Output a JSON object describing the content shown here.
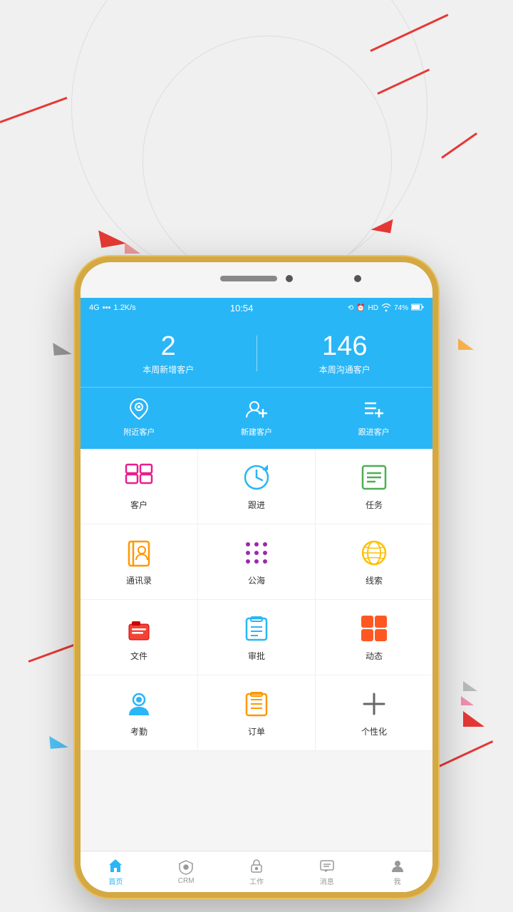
{
  "background": {
    "color": "#f0f0f0"
  },
  "statusBar": {
    "network": "4G",
    "signal": "4G ⬆",
    "speed": "1.2K/s",
    "time": "10:54",
    "battery": "74%",
    "icons": "HD"
  },
  "header": {
    "stat1_number": "2",
    "stat1_label": "本周新增客户",
    "stat2_number": "146",
    "stat2_label": "本周沟通客户"
  },
  "quickActions": [
    {
      "id": "nearby",
      "label": "附近客户",
      "icon": "location"
    },
    {
      "id": "new-client",
      "label": "新建客户",
      "icon": "person-add"
    },
    {
      "id": "follow-up",
      "label": "跟进客户",
      "icon": "list-add"
    }
  ],
  "gridItems": [
    {
      "id": "customers",
      "label": "客户",
      "icon": "grid",
      "color": "#e91e8c"
    },
    {
      "id": "follow",
      "label": "跟进",
      "icon": "refresh-time",
      "color": "#29b6f6"
    },
    {
      "id": "tasks",
      "label": "任务",
      "icon": "list",
      "color": "#4caf50"
    },
    {
      "id": "contacts",
      "label": "通讯录",
      "icon": "book",
      "color": "#ff9800"
    },
    {
      "id": "public-sea",
      "label": "公海",
      "icon": "dots",
      "color": "#9c27b0"
    },
    {
      "id": "leads",
      "label": "线索",
      "icon": "globe",
      "color": "#ffc107"
    },
    {
      "id": "files",
      "label": "文件",
      "icon": "briefcase",
      "color": "#f44336"
    },
    {
      "id": "approval",
      "label": "审批",
      "icon": "calendar",
      "color": "#29b6f6"
    },
    {
      "id": "dynamics",
      "label": "动态",
      "icon": "grid4",
      "color": "#ff5722"
    },
    {
      "id": "attendance",
      "label": "考勤",
      "icon": "person",
      "color": "#29b6f6"
    },
    {
      "id": "orders",
      "label": "订单",
      "icon": "order-list",
      "color": "#ff9800"
    },
    {
      "id": "personalize",
      "label": "个性化",
      "icon": "plus",
      "color": "#666"
    }
  ],
  "bottomTabs": [
    {
      "id": "home",
      "label": "首页",
      "active": true,
      "icon": "home"
    },
    {
      "id": "crm",
      "label": "CRM",
      "active": false,
      "icon": "shield"
    },
    {
      "id": "work",
      "label": "工作",
      "active": false,
      "icon": "lock"
    },
    {
      "id": "messages",
      "label": "消息",
      "active": false,
      "icon": "chat"
    },
    {
      "id": "me",
      "label": "我",
      "active": false,
      "icon": "person-circle"
    }
  ]
}
